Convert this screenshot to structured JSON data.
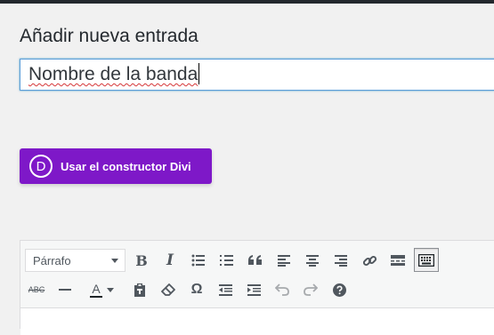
{
  "page": {
    "heading": "Añadir nueva entrada"
  },
  "title_field": {
    "value": "Nombre de la banda"
  },
  "divi": {
    "logo_letter": "D",
    "button_label": "Usar el constructor Divi",
    "color": "#7e18c8"
  },
  "toolbar": {
    "format_selected": "Párrafo",
    "row1": [
      "bold-icon",
      "italic-icon",
      "bulleted-list-icon",
      "numbered-list-icon",
      "blockquote-icon",
      "align-left-icon",
      "align-center-icon",
      "align-right-icon",
      "link-icon",
      "read-more-icon",
      "toolbar-toggle-icon"
    ],
    "row2": [
      "strikethrough-icon",
      "horizontal-line-icon",
      "text-color-icon",
      "paste-text-icon",
      "clear-formatting-icon",
      "special-character-icon",
      "outdent-icon",
      "indent-icon",
      "undo-icon",
      "redo-icon",
      "help-icon"
    ],
    "bold_glyph": "B",
    "italic_glyph": "I",
    "strike_glyph": "ABC",
    "text_color_glyph": "A",
    "omega_glyph": "Ω"
  }
}
